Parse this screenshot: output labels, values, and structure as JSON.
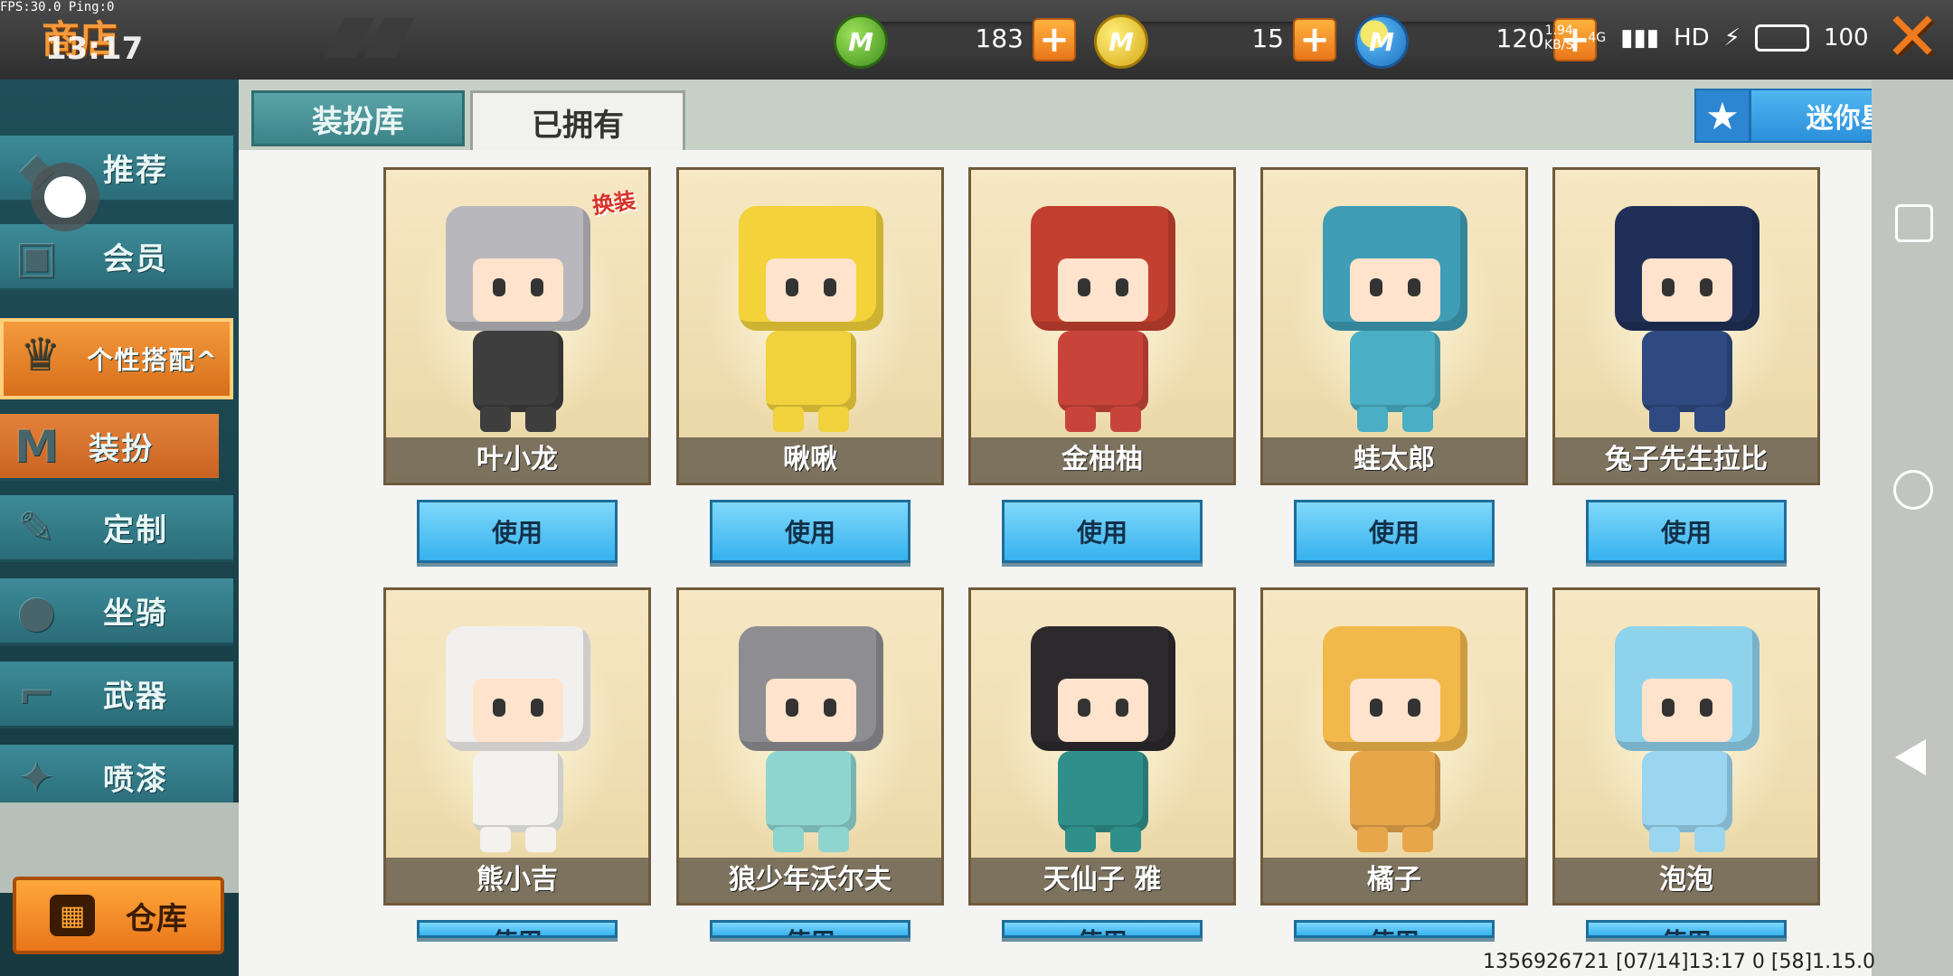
{
  "debug": {
    "fps": "FPS:30.0  Ping:0"
  },
  "header": {
    "title": "商店",
    "time": "13:17"
  },
  "currencies": [
    {
      "name": "green-coin",
      "value": "183",
      "color": "#5cb82e",
      "symbol": "M"
    },
    {
      "name": "gold-coin",
      "value": "15",
      "color": "#f2c21f",
      "symbol": "M"
    },
    {
      "name": "blue-coin",
      "value": "120",
      "color": "#3a93dc",
      "symbol": "M"
    }
  ],
  "statusbar": {
    "net_speed": "1.94",
    "net_unit": "KB/S",
    "network": "4G",
    "hd": "HD",
    "battery": "100"
  },
  "sidebar": {
    "items": [
      {
        "label": "推荐",
        "icon": "recommend-icon"
      },
      {
        "label": "会员",
        "icon": "member-icon"
      },
      {
        "label": "个性搭配^",
        "icon": "trophy-icon"
      },
      {
        "label": "装扮",
        "icon": "shirt-icon"
      },
      {
        "label": "定制",
        "icon": "pencil-icon"
      },
      {
        "label": "坐骑",
        "icon": "mount-icon"
      },
      {
        "label": "武器",
        "icon": "gun-icon"
      },
      {
        "label": "喷漆",
        "icon": "spray-icon"
      }
    ],
    "warehouse": "仓库"
  },
  "tabs": [
    {
      "label": "装扮库",
      "active": false
    },
    {
      "label": "已拥有",
      "active": true
    }
  ],
  "workshop": {
    "label": "迷你星工场"
  },
  "skins": [
    {
      "name": "叶小龙",
      "button": "使用",
      "badge": "换装",
      "head": "#b8b8bc",
      "body": "#3e3e3e"
    },
    {
      "name": "啾啾",
      "button": "使用",
      "badge": "",
      "head": "#f3d23a",
      "body": "#f1d13c"
    },
    {
      "name": "金柚柚",
      "button": "使用",
      "badge": "",
      "head": "#c2402f",
      "body": "#c8443a"
    },
    {
      "name": "蛙太郎",
      "button": "使用",
      "badge": "",
      "head": "#3f9db5",
      "body": "#4aaec4"
    },
    {
      "name": "兔子先生拉比",
      "button": "使用",
      "badge": "",
      "head": "#1f2f57",
      "body": "#2e4a80"
    },
    {
      "name": "熊小吉",
      "button": "使用",
      "badge": "",
      "head": "#f1f0ee",
      "body": "#f3f2ef"
    },
    {
      "name": "狼少年沃尔夫",
      "button": "使用",
      "badge": "",
      "head": "#8e8e92",
      "body": "#8fd5cf"
    },
    {
      "name": "天仙子 雅",
      "button": "使用",
      "badge": "",
      "head": "#2d2a2e",
      "body": "#2f8f8a"
    },
    {
      "name": "橘子",
      "button": "使用",
      "badge": "",
      "head": "#f1b84a",
      "body": "#e8a64a"
    },
    {
      "name": "泡泡",
      "button": "使用",
      "badge": "",
      "head": "#8fd2ec",
      "body": "#9ad6f0"
    }
  ],
  "footer": {
    "info": "1356926721   [07/14]13:17 0    [58]1.15.0"
  }
}
